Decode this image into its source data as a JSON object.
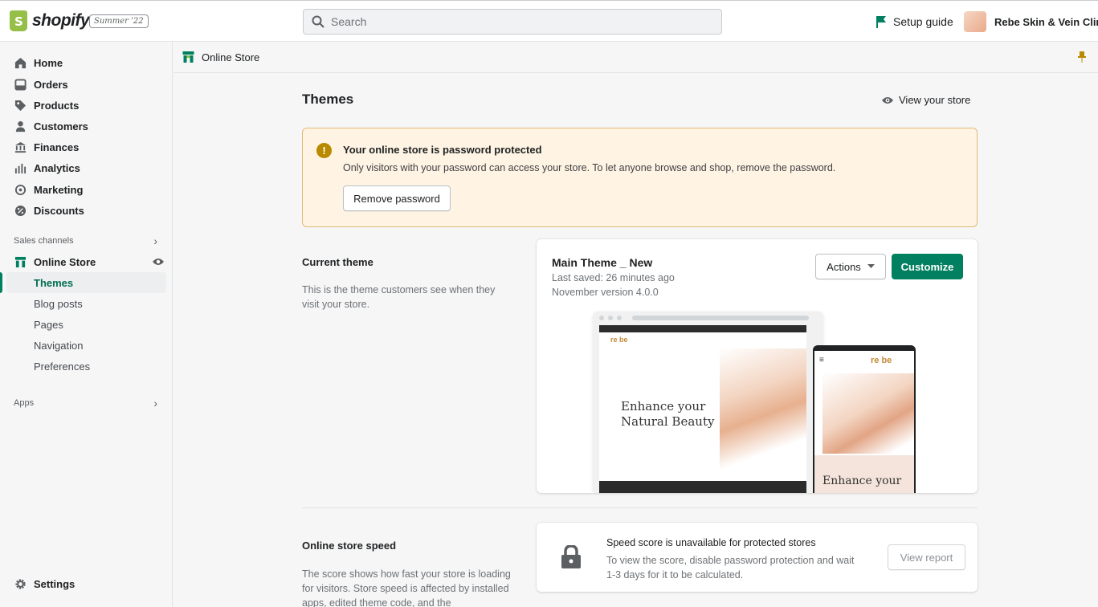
{
  "topbar": {
    "logo_text": "shopify",
    "edition": "Summer '22",
    "search_placeholder": "Search",
    "setup_guide": "Setup guide",
    "store_name": "Rebe Skin & Vein Clinic"
  },
  "sidebar": {
    "items": [
      {
        "label": "Home",
        "icon": "home-icon"
      },
      {
        "label": "Orders",
        "icon": "orders-icon"
      },
      {
        "label": "Products",
        "icon": "tag-icon"
      },
      {
        "label": "Customers",
        "icon": "person-icon"
      },
      {
        "label": "Finances",
        "icon": "bank-icon"
      },
      {
        "label": "Analytics",
        "icon": "bar-chart-icon"
      },
      {
        "label": "Marketing",
        "icon": "target-icon"
      },
      {
        "label": "Discounts",
        "icon": "discount-icon"
      }
    ],
    "sales_channels_label": "Sales channels",
    "online_store": "Online Store",
    "sub_items": [
      "Themes",
      "Blog posts",
      "Pages",
      "Navigation",
      "Preferences"
    ],
    "apps_label": "Apps",
    "settings": "Settings"
  },
  "breadcrumb": {
    "label": "Online Store"
  },
  "page": {
    "title": "Themes",
    "view_store": "View your store"
  },
  "banner": {
    "title": "Your online store is password protected",
    "text": "Only visitors with your password can access your store. To let anyone browse and shop, remove the password.",
    "button": "Remove password"
  },
  "current_theme": {
    "heading": "Current theme",
    "desc": "This is the theme customers see when they visit your store.",
    "name": "Main Theme _ New",
    "last_saved": "Last saved: 26 minutes ago",
    "version": "November version 4.0.0",
    "actions_label": "Actions",
    "customize_label": "Customize",
    "preview_desktop_headline_1": "Enhance your",
    "preview_desktop_headline_2": "Natural Beauty",
    "preview_mobile_headline": "Enhance your",
    "preview_brand": "re be"
  },
  "speed": {
    "heading": "Online store speed",
    "desc": "The score shows how fast your store is loading for visitors. Store speed is affected by installed apps, edited theme code, and the",
    "card_title": "Speed score is unavailable for protected stores",
    "card_text": "To view the score, disable password protection and wait 1-3 days for it to be calculated.",
    "button": "View report"
  },
  "colors": {
    "accent": "#008060",
    "warning_bg": "#fff4e4",
    "warning_border": "#e1b878"
  }
}
